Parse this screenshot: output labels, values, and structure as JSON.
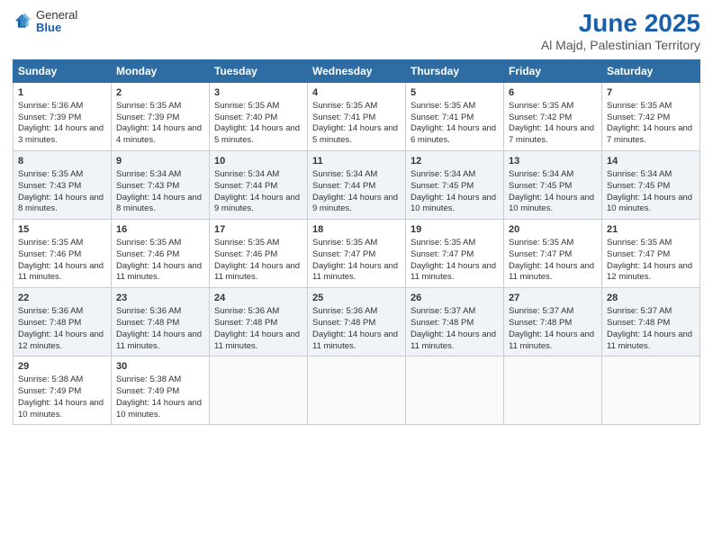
{
  "logo": {
    "general": "General",
    "blue": "Blue"
  },
  "title": "June 2025",
  "subtitle": "Al Majd, Palestinian Territory",
  "headers": [
    "Sunday",
    "Monday",
    "Tuesday",
    "Wednesday",
    "Thursday",
    "Friday",
    "Saturday"
  ],
  "weeks": [
    [
      {
        "day": "1",
        "sunrise": "Sunrise: 5:36 AM",
        "sunset": "Sunset: 7:39 PM",
        "daylight": "Daylight: 14 hours and 3 minutes."
      },
      {
        "day": "2",
        "sunrise": "Sunrise: 5:35 AM",
        "sunset": "Sunset: 7:39 PM",
        "daylight": "Daylight: 14 hours and 4 minutes."
      },
      {
        "day": "3",
        "sunrise": "Sunrise: 5:35 AM",
        "sunset": "Sunset: 7:40 PM",
        "daylight": "Daylight: 14 hours and 5 minutes."
      },
      {
        "day": "4",
        "sunrise": "Sunrise: 5:35 AM",
        "sunset": "Sunset: 7:41 PM",
        "daylight": "Daylight: 14 hours and 5 minutes."
      },
      {
        "day": "5",
        "sunrise": "Sunrise: 5:35 AM",
        "sunset": "Sunset: 7:41 PM",
        "daylight": "Daylight: 14 hours and 6 minutes."
      },
      {
        "day": "6",
        "sunrise": "Sunrise: 5:35 AM",
        "sunset": "Sunset: 7:42 PM",
        "daylight": "Daylight: 14 hours and 7 minutes."
      },
      {
        "day": "7",
        "sunrise": "Sunrise: 5:35 AM",
        "sunset": "Sunset: 7:42 PM",
        "daylight": "Daylight: 14 hours and 7 minutes."
      }
    ],
    [
      {
        "day": "8",
        "sunrise": "Sunrise: 5:35 AM",
        "sunset": "Sunset: 7:43 PM",
        "daylight": "Daylight: 14 hours and 8 minutes."
      },
      {
        "day": "9",
        "sunrise": "Sunrise: 5:34 AM",
        "sunset": "Sunset: 7:43 PM",
        "daylight": "Daylight: 14 hours and 8 minutes."
      },
      {
        "day": "10",
        "sunrise": "Sunrise: 5:34 AM",
        "sunset": "Sunset: 7:44 PM",
        "daylight": "Daylight: 14 hours and 9 minutes."
      },
      {
        "day": "11",
        "sunrise": "Sunrise: 5:34 AM",
        "sunset": "Sunset: 7:44 PM",
        "daylight": "Daylight: 14 hours and 9 minutes."
      },
      {
        "day": "12",
        "sunrise": "Sunrise: 5:34 AM",
        "sunset": "Sunset: 7:45 PM",
        "daylight": "Daylight: 14 hours and 10 minutes."
      },
      {
        "day": "13",
        "sunrise": "Sunrise: 5:34 AM",
        "sunset": "Sunset: 7:45 PM",
        "daylight": "Daylight: 14 hours and 10 minutes."
      },
      {
        "day": "14",
        "sunrise": "Sunrise: 5:34 AM",
        "sunset": "Sunset: 7:45 PM",
        "daylight": "Daylight: 14 hours and 10 minutes."
      }
    ],
    [
      {
        "day": "15",
        "sunrise": "Sunrise: 5:35 AM",
        "sunset": "Sunset: 7:46 PM",
        "daylight": "Daylight: 14 hours and 11 minutes."
      },
      {
        "day": "16",
        "sunrise": "Sunrise: 5:35 AM",
        "sunset": "Sunset: 7:46 PM",
        "daylight": "Daylight: 14 hours and 11 minutes."
      },
      {
        "day": "17",
        "sunrise": "Sunrise: 5:35 AM",
        "sunset": "Sunset: 7:46 PM",
        "daylight": "Daylight: 14 hours and 11 minutes."
      },
      {
        "day": "18",
        "sunrise": "Sunrise: 5:35 AM",
        "sunset": "Sunset: 7:47 PM",
        "daylight": "Daylight: 14 hours and 11 minutes."
      },
      {
        "day": "19",
        "sunrise": "Sunrise: 5:35 AM",
        "sunset": "Sunset: 7:47 PM",
        "daylight": "Daylight: 14 hours and 11 minutes."
      },
      {
        "day": "20",
        "sunrise": "Sunrise: 5:35 AM",
        "sunset": "Sunset: 7:47 PM",
        "daylight": "Daylight: 14 hours and 11 minutes."
      },
      {
        "day": "21",
        "sunrise": "Sunrise: 5:35 AM",
        "sunset": "Sunset: 7:47 PM",
        "daylight": "Daylight: 14 hours and 12 minutes."
      }
    ],
    [
      {
        "day": "22",
        "sunrise": "Sunrise: 5:36 AM",
        "sunset": "Sunset: 7:48 PM",
        "daylight": "Daylight: 14 hours and 12 minutes."
      },
      {
        "day": "23",
        "sunrise": "Sunrise: 5:36 AM",
        "sunset": "Sunset: 7:48 PM",
        "daylight": "Daylight: 14 hours and 11 minutes."
      },
      {
        "day": "24",
        "sunrise": "Sunrise: 5:36 AM",
        "sunset": "Sunset: 7:48 PM",
        "daylight": "Daylight: 14 hours and 11 minutes."
      },
      {
        "day": "25",
        "sunrise": "Sunrise: 5:36 AM",
        "sunset": "Sunset: 7:48 PM",
        "daylight": "Daylight: 14 hours and 11 minutes."
      },
      {
        "day": "26",
        "sunrise": "Sunrise: 5:37 AM",
        "sunset": "Sunset: 7:48 PM",
        "daylight": "Daylight: 14 hours and 11 minutes."
      },
      {
        "day": "27",
        "sunrise": "Sunrise: 5:37 AM",
        "sunset": "Sunset: 7:48 PM",
        "daylight": "Daylight: 14 hours and 11 minutes."
      },
      {
        "day": "28",
        "sunrise": "Sunrise: 5:37 AM",
        "sunset": "Sunset: 7:48 PM",
        "daylight": "Daylight: 14 hours and 11 minutes."
      }
    ],
    [
      {
        "day": "29",
        "sunrise": "Sunrise: 5:38 AM",
        "sunset": "Sunset: 7:49 PM",
        "daylight": "Daylight: 14 hours and 10 minutes."
      },
      {
        "day": "30",
        "sunrise": "Sunrise: 5:38 AM",
        "sunset": "Sunset: 7:49 PM",
        "daylight": "Daylight: 14 hours and 10 minutes."
      },
      null,
      null,
      null,
      null,
      null
    ]
  ]
}
